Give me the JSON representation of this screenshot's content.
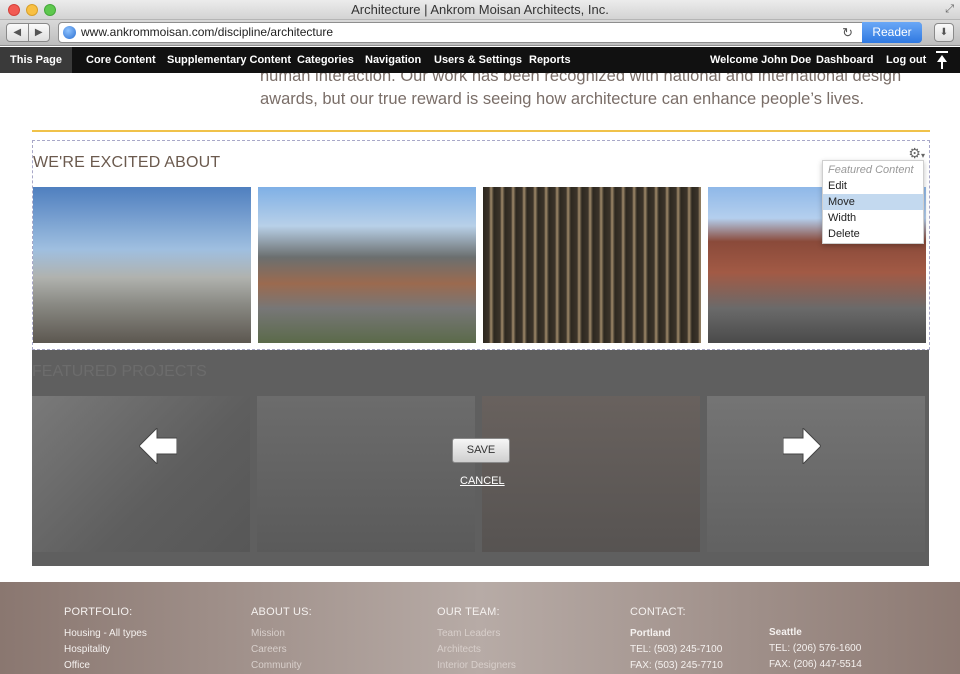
{
  "window": {
    "title": "Architecture | Ankrom Moisan Architects, Inc."
  },
  "browser": {
    "url": "www.ankrommoisan.com/discipline/architecture",
    "reader_label": "Reader"
  },
  "admin_bar": {
    "this_page": "This Page",
    "menu": [
      "Core Content",
      "Supplementary Content",
      "Categories",
      "Navigation",
      "Users & Settings",
      "Reports"
    ],
    "welcome": "Welcome John Doe",
    "dashboard": "Dashboard",
    "logout": "Log out"
  },
  "intro": {
    "text": "human interaction. Our work has been recognized with national and international design awards, but our true reward is seeing how architecture can enhance people’s lives."
  },
  "excited": {
    "title": "WE'RE EXCITED ABOUT"
  },
  "context_menu": {
    "title": "Featured Content",
    "items": [
      "Edit",
      "Move",
      "Width",
      "Delete"
    ],
    "active": "Move"
  },
  "featured": {
    "title": "FEATURED PROJECTS",
    "save_label": "SAVE",
    "cancel_label": "CANCEL"
  },
  "footer": {
    "portfolio": {
      "heading": "PORTFOLIO:",
      "items": [
        "Housing - All types",
        "Hospitality",
        "Office"
      ]
    },
    "about": {
      "heading": "ABOUT US:",
      "items": [
        "Mission",
        "Careers",
        "Community"
      ]
    },
    "team": {
      "heading": "OUR TEAM:",
      "items": [
        "Team Leaders",
        "Architects",
        "Interior Designers"
      ]
    },
    "contact": {
      "heading": "CONTACT:",
      "portland": {
        "city": "Portland",
        "tel": "TEL: (503) 245-7100",
        "fax": "FAX: (503) 245-7710"
      },
      "seattle": {
        "city": "Seattle",
        "tel": "TEL: (206) 576-1600",
        "fax": "FAX: (206) 447-5514"
      }
    }
  },
  "colors": {
    "accent_gold": "#f0c24a",
    "reader_blue": "#2f78e0",
    "admin_bar": "#111111"
  }
}
